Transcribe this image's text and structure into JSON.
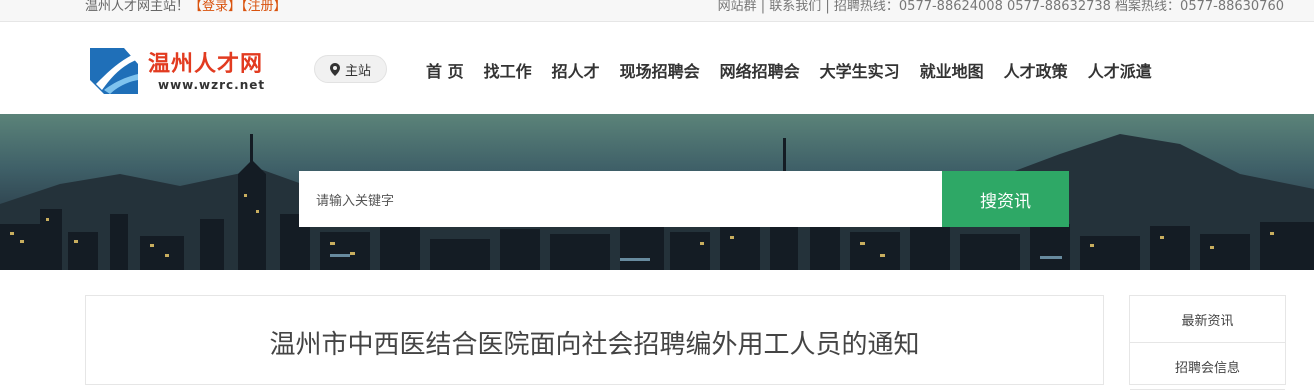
{
  "topbar": {
    "welcome": "温州人才网主站！",
    "login": "【登录】",
    "register": "【注册】",
    "links": "网站群 | 联系我们 | 招聘热线：0577-88624008 0577-88632738 档案热线：0577-88630760"
  },
  "logo": {
    "name": "温州人才网",
    "url": "www.wzrc.net"
  },
  "station": {
    "label": "主站",
    "icon": "location-pin-icon"
  },
  "nav": [
    "首 页",
    "找工作",
    "招人才",
    "现场招聘会",
    "网络招聘会",
    "大学生实习",
    "就业地图",
    "人才政策",
    "人才派遣"
  ],
  "search": {
    "placeholder": "请输入关键字",
    "button": "搜资讯"
  },
  "article": {
    "title": "温州市中西医结合医院面向社会招聘编外用工人员的通知"
  },
  "aside": {
    "items": [
      "最新资讯",
      "招聘会信息"
    ]
  },
  "colors": {
    "accent_red": "#e23b20",
    "topbar_link": "#d9530e",
    "search_button": "#2ea866"
  }
}
